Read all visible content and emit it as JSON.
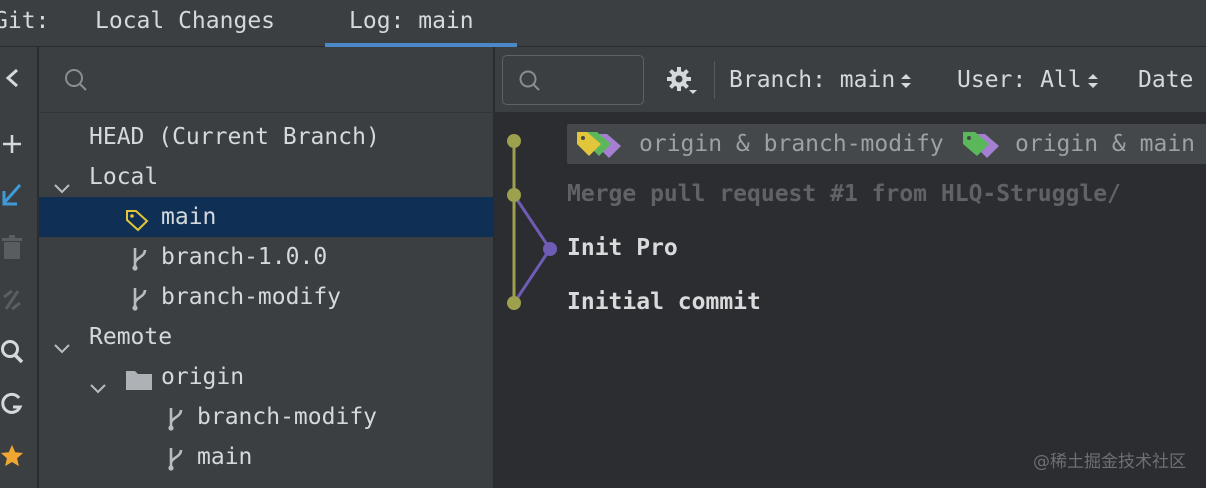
{
  "tabbar": {
    "git_label": "Git:",
    "tabs": [
      {
        "label": "Local Changes",
        "active": false
      },
      {
        "label": "Log: main",
        "active": true
      }
    ]
  },
  "toolbar": {
    "icons": [
      "collapse-icon",
      "add-icon",
      "checkout-icon",
      "delete-icon",
      "compare-icon",
      "search-icon",
      "refresh-icon",
      "favorite-icon"
    ]
  },
  "tree": {
    "search_placeholder": "",
    "head_label": "HEAD (Current Branch)",
    "local_label": "Local",
    "local_branches": [
      "main",
      "branch-1.0.0",
      "branch-modify"
    ],
    "remote_label": "Remote",
    "remote_name": "origin",
    "remote_branches": [
      "branch-modify",
      "main"
    ],
    "selected": "main"
  },
  "log": {
    "search_placeholder": "",
    "filters": {
      "branch": "Branch: main",
      "user": "User: All",
      "date": "Date"
    },
    "refs": [
      {
        "text": "origin & branch-modify"
      },
      {
        "text": "origin & main"
      }
    ],
    "commits": [
      {
        "message": "Merge pull request #1 from HLQ-Struggle/",
        "dimmed": true
      },
      {
        "message": "Init Pro",
        "dimmed": false
      },
      {
        "message": "Initial commit",
        "dimmed": false
      }
    ]
  },
  "colors": {
    "graph_main": "#9da14e",
    "graph_branch": "#6f5cb5",
    "tag_yellow": "#e1c53a",
    "tag_purple": "#a57fd1",
    "tag_green": "#5bb85a",
    "selection": "#0f3054",
    "accent": "#4a88c7"
  },
  "watermark": "@稀土掘金技术社区"
}
